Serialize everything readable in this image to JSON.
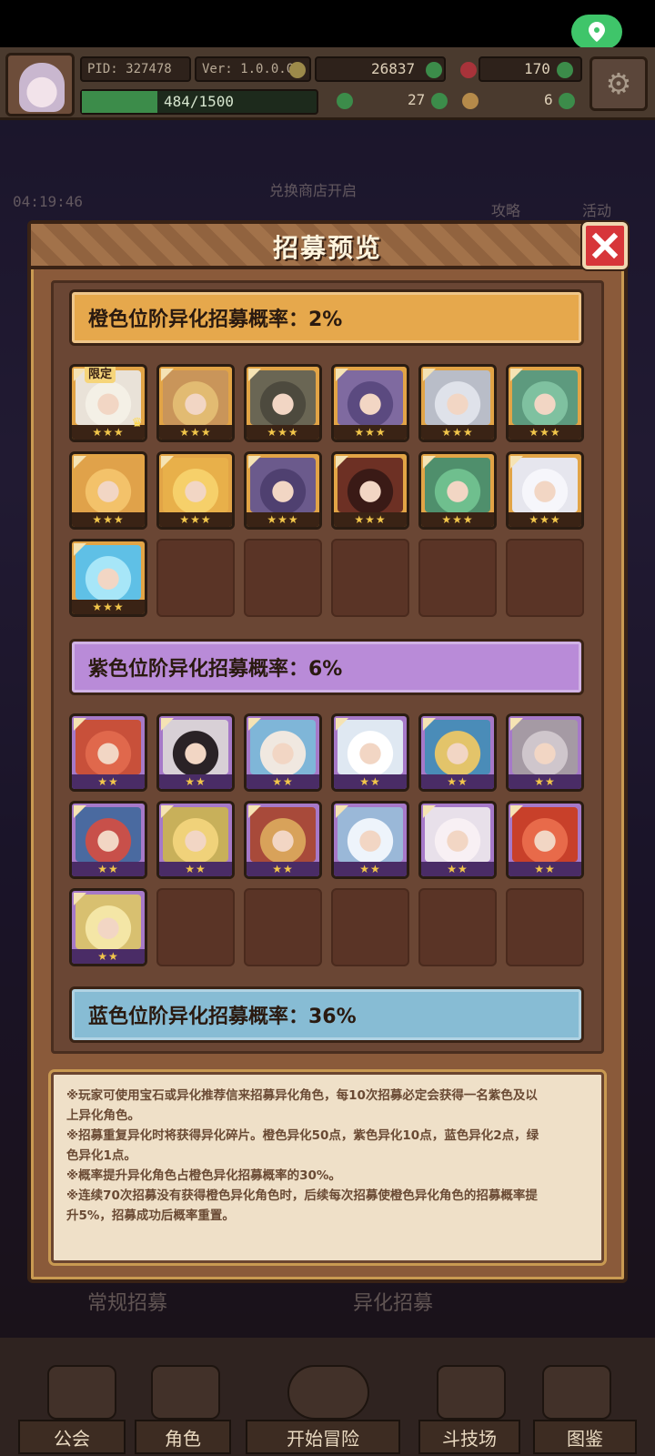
{
  "topbar": {
    "pid": "PID: 327478",
    "version": "Ver: 1.0.0.0",
    "currency_a": "26837",
    "currency_b": "170",
    "exp": "484/1500",
    "exp_progress": 0.3227,
    "currency_c": "27",
    "currency_d": "6"
  },
  "background": {
    "timer": "04:19:46",
    "banner": "兑换商店开启",
    "btn_strategy": "攻略",
    "btn_event": "活动",
    "recruit_normal": "常规招募",
    "recruit_special": "异化招募"
  },
  "modal": {
    "title": "招募预览",
    "orange_label": "橙色位阶异化招募概率：2%",
    "purple_label": "紫色位阶异化招募概率：6%",
    "blue_label": "蓝色位阶异化招募概率：36%",
    "limited_tag": "限定",
    "star3": "★★★",
    "star2": "★★",
    "notes": [
      "※玩家可使用宝石或异化推荐信来招募异化角色，每10次招募必定会获得一名紫色及以",
      "上异化角色。",
      "※招募重复异化时将获得异化碎片。橙色异化50点，紫色异化10点，蓝色异化2点，绿",
      "色异化1点。",
      "※概率提升异化角色占橙色异化招募概率的30%。",
      "※连续70次招募没有获得橙色异化角色时，后续每次招募使橙色异化角色的招募概率提",
      "升5%，招募成功后概率重置。"
    ]
  },
  "orange_cards": [
    {
      "hue": "#e9e2d8",
      "hair": "#f4f0e6",
      "limited": true
    },
    {
      "hue": "#c9955a",
      "hair": "#e2bb72"
    },
    {
      "hue": "#6a6654",
      "hair": "#4d4a3e"
    },
    {
      "hue": "#7f6aa0",
      "hair": "#5b4a80"
    },
    {
      "hue": "#b9bdc8",
      "hair": "#dfe2ea"
    },
    {
      "hue": "#5d9a7e",
      "hair": "#7fc1a0"
    },
    {
      "hue": "#e0a24a",
      "hair": "#f3c26a"
    },
    {
      "hue": "#e8b04a",
      "hair": "#f6d06a"
    },
    {
      "hue": "#6b5a8c",
      "hair": "#4f4070"
    },
    {
      "hue": "#6d3024",
      "hair": "#3a1a16"
    },
    {
      "hue": "#4f8f6c",
      "hair": "#6fbf8e"
    },
    {
      "hue": "#e6e6ee",
      "hair": "#f6f6fb"
    },
    {
      "hue": "#5fc0e6",
      "hair": "#a7e6f8"
    }
  ],
  "purple_cards": [
    {
      "hue": "#c8503a",
      "hair": "#e0684c"
    },
    {
      "hue": "#d8d0d6",
      "hair": "#2a2226"
    },
    {
      "hue": "#7fb6d8",
      "hair": "#f0e8e0"
    },
    {
      "hue": "#dfe8f2",
      "hair": "#ffffff"
    },
    {
      "hue": "#4a8cb8",
      "hair": "#e3c46a"
    },
    {
      "hue": "#a59aa4",
      "hair": "#cfc6cc"
    },
    {
      "hue": "#4a6aa0",
      "hair": "#c8504a"
    },
    {
      "hue": "#c8b05a",
      "hair": "#f0d27a"
    },
    {
      "hue": "#a84a3a",
      "hair": "#d8a25a"
    },
    {
      "hue": "#9ab8d8",
      "hair": "#eef4fb"
    },
    {
      "hue": "#e8e0ea",
      "hair": "#f8f0f4"
    },
    {
      "hue": "#c8402a",
      "hair": "#e86a4a"
    },
    {
      "hue": "#d8c070",
      "hair": "#f4e6a6"
    }
  ],
  "bottom_nav": {
    "guild": "公会",
    "character": "角色",
    "adventure": "开始冒险",
    "arena": "斗技场",
    "codex": "图鉴"
  },
  "colors": {
    "orange_tier": "#e6a84c",
    "purple_tier": "#b98bd8",
    "blue_tier": "#87bcd4",
    "close_red": "#d7363a",
    "location_green": "#3fc56a"
  }
}
